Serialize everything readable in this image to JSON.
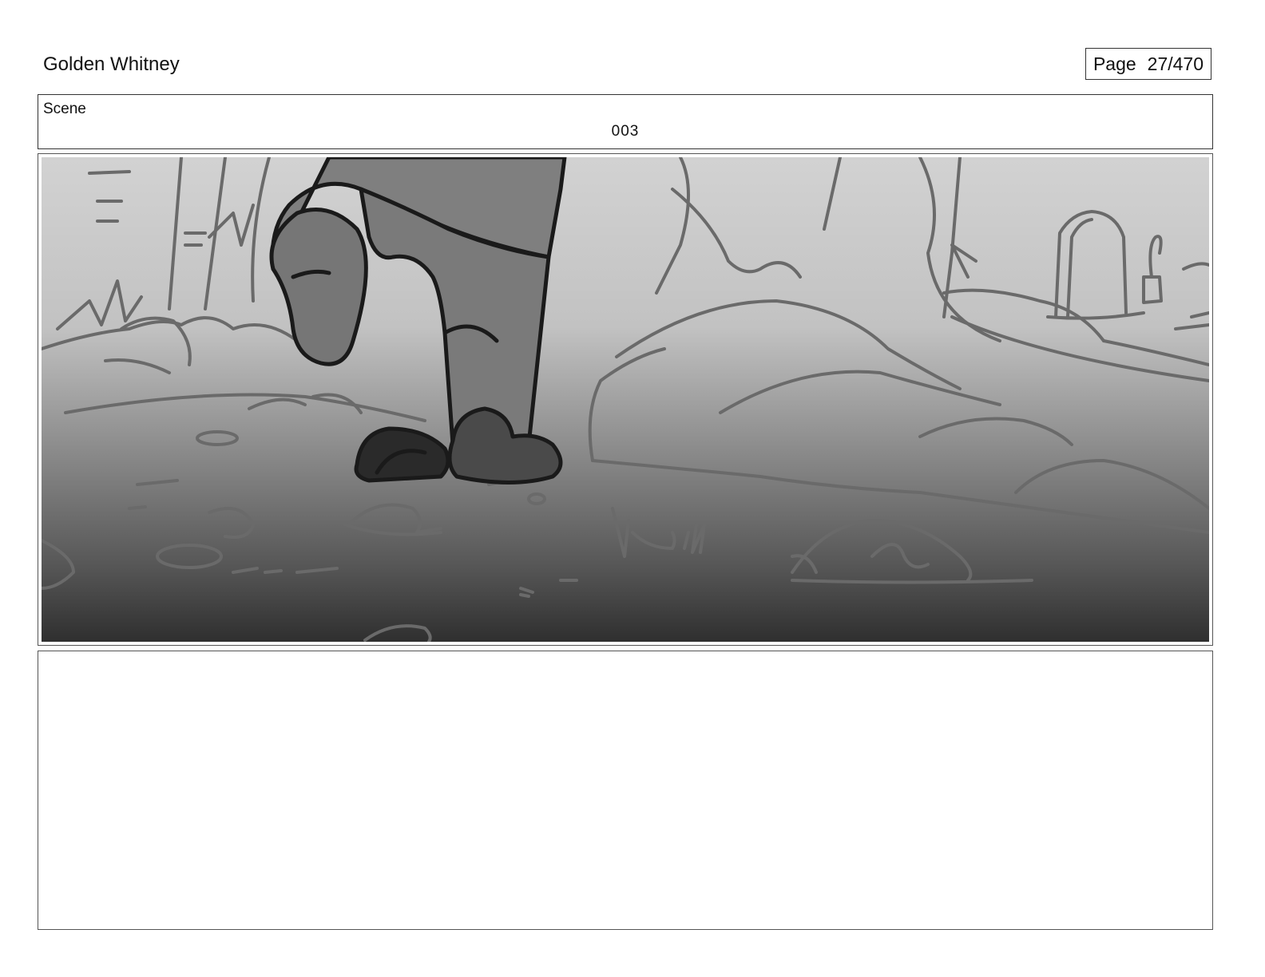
{
  "header": {
    "project_title": "Golden Whitney",
    "page_label": "Page",
    "page_number": "27/470"
  },
  "scene": {
    "label": "Scene",
    "number": "003"
  },
  "panel": {
    "image_description_icon": "storyboard-sketch-feet-in-graveyard",
    "gradient_top_color": "#cfcfcf",
    "gradient_bottom_color": "#333333"
  },
  "notes": {
    "text": ""
  }
}
